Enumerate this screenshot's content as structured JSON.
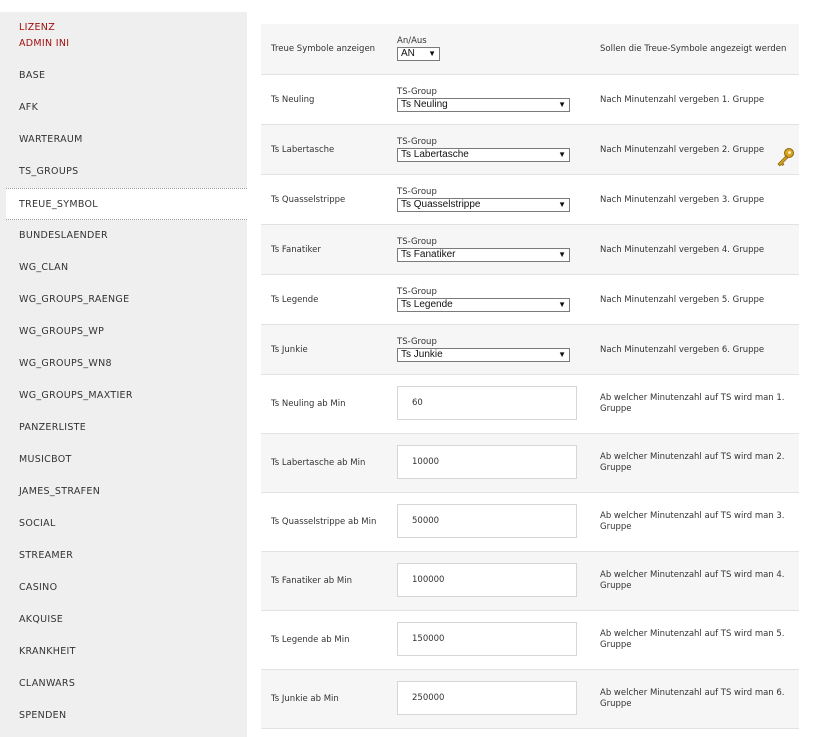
{
  "sidebar": {
    "header_line1": "LIZENZ",
    "header_line2": "ADMIN INI",
    "items": [
      "BASE",
      "AFK",
      "WARTERAUM",
      "TS_GROUPS",
      "TREUE_SYMBOL",
      "BUNDESLAENDER",
      "WG_CLAN",
      "WG_GROUPS_RAENGE",
      "WG_GROUPS_WP",
      "WG_GROUPS_WN8",
      "WG_GROUPS_MAXTIER",
      "PANZERLISTE",
      "MUSICBOT",
      "JAMES_STRAFEN",
      "SOCIAL",
      "STREAMER",
      "CASINO",
      "AKQUISE",
      "KRANKHEIT",
      "CLANWARS",
      "SPENDEN"
    ],
    "active": "TREUE_SYMBOL"
  },
  "settings": {
    "toggle_row": {
      "label": "Treue Symbole anzeigen",
      "field_label": "An/Aus",
      "value": "AN",
      "description": "Sollen die Treue-Symbole angezeigt werden"
    },
    "group_rows": [
      {
        "label": "Ts Neuling",
        "field_label": "TS-Group",
        "value": "Ts Neuling",
        "description": "Nach Minutenzahl vergeben 1. Gruppe"
      },
      {
        "label": "Ts Labertasche",
        "field_label": "TS-Group",
        "value": "Ts Labertasche",
        "description": "Nach Minutenzahl vergeben 2. Gruppe"
      },
      {
        "label": "Ts Quasselstrippe",
        "field_label": "TS-Group",
        "value": "Ts Quasselstrippe",
        "description": "Nach Minutenzahl vergeben 3. Gruppe"
      },
      {
        "label": "Ts Fanatiker",
        "field_label": "TS-Group",
        "value": "Ts Fanatiker",
        "description": "Nach Minutenzahl vergeben 4. Gruppe"
      },
      {
        "label": "Ts Legende",
        "field_label": "TS-Group",
        "value": "Ts Legende",
        "description": "Nach Minutenzahl vergeben 5. Gruppe"
      },
      {
        "label": "Ts Junkie",
        "field_label": "TS-Group",
        "value": "Ts Junkie",
        "description": "Nach Minutenzahl vergeben 6. Gruppe"
      }
    ],
    "minute_rows": [
      {
        "label": "Ts Neuling ab Min",
        "value": "60",
        "description": "Ab welcher Minutenzahl auf TS wird man 1. Gruppe"
      },
      {
        "label": "Ts Labertasche ab Min",
        "value": "10000",
        "description": "Ab welcher Minutenzahl auf TS wird man 2. Gruppe"
      },
      {
        "label": "Ts Quasselstrippe ab Min",
        "value": "50000",
        "description": "Ab welcher Minutenzahl auf TS wird man 3. Gruppe"
      },
      {
        "label": "Ts Fanatiker ab Min",
        "value": "100000",
        "description": "Ab welcher Minutenzahl auf TS wird man 4. Gruppe"
      },
      {
        "label": "Ts Legende ab Min",
        "value": "150000",
        "description": "Ab welcher Minutenzahl auf TS wird man 5. Gruppe"
      },
      {
        "label": "Ts Junkie ab Min",
        "value": "250000",
        "description": "Ab welcher Minutenzahl auf TS wird man 6. Gruppe"
      }
    ]
  },
  "icons": {
    "key": "key-icon",
    "dropdown_arrow": "triangle-down"
  },
  "colors": {
    "sidebar_bg": "#efefef",
    "header_red": "#a01010",
    "row_shade": "#f6f6f6"
  }
}
